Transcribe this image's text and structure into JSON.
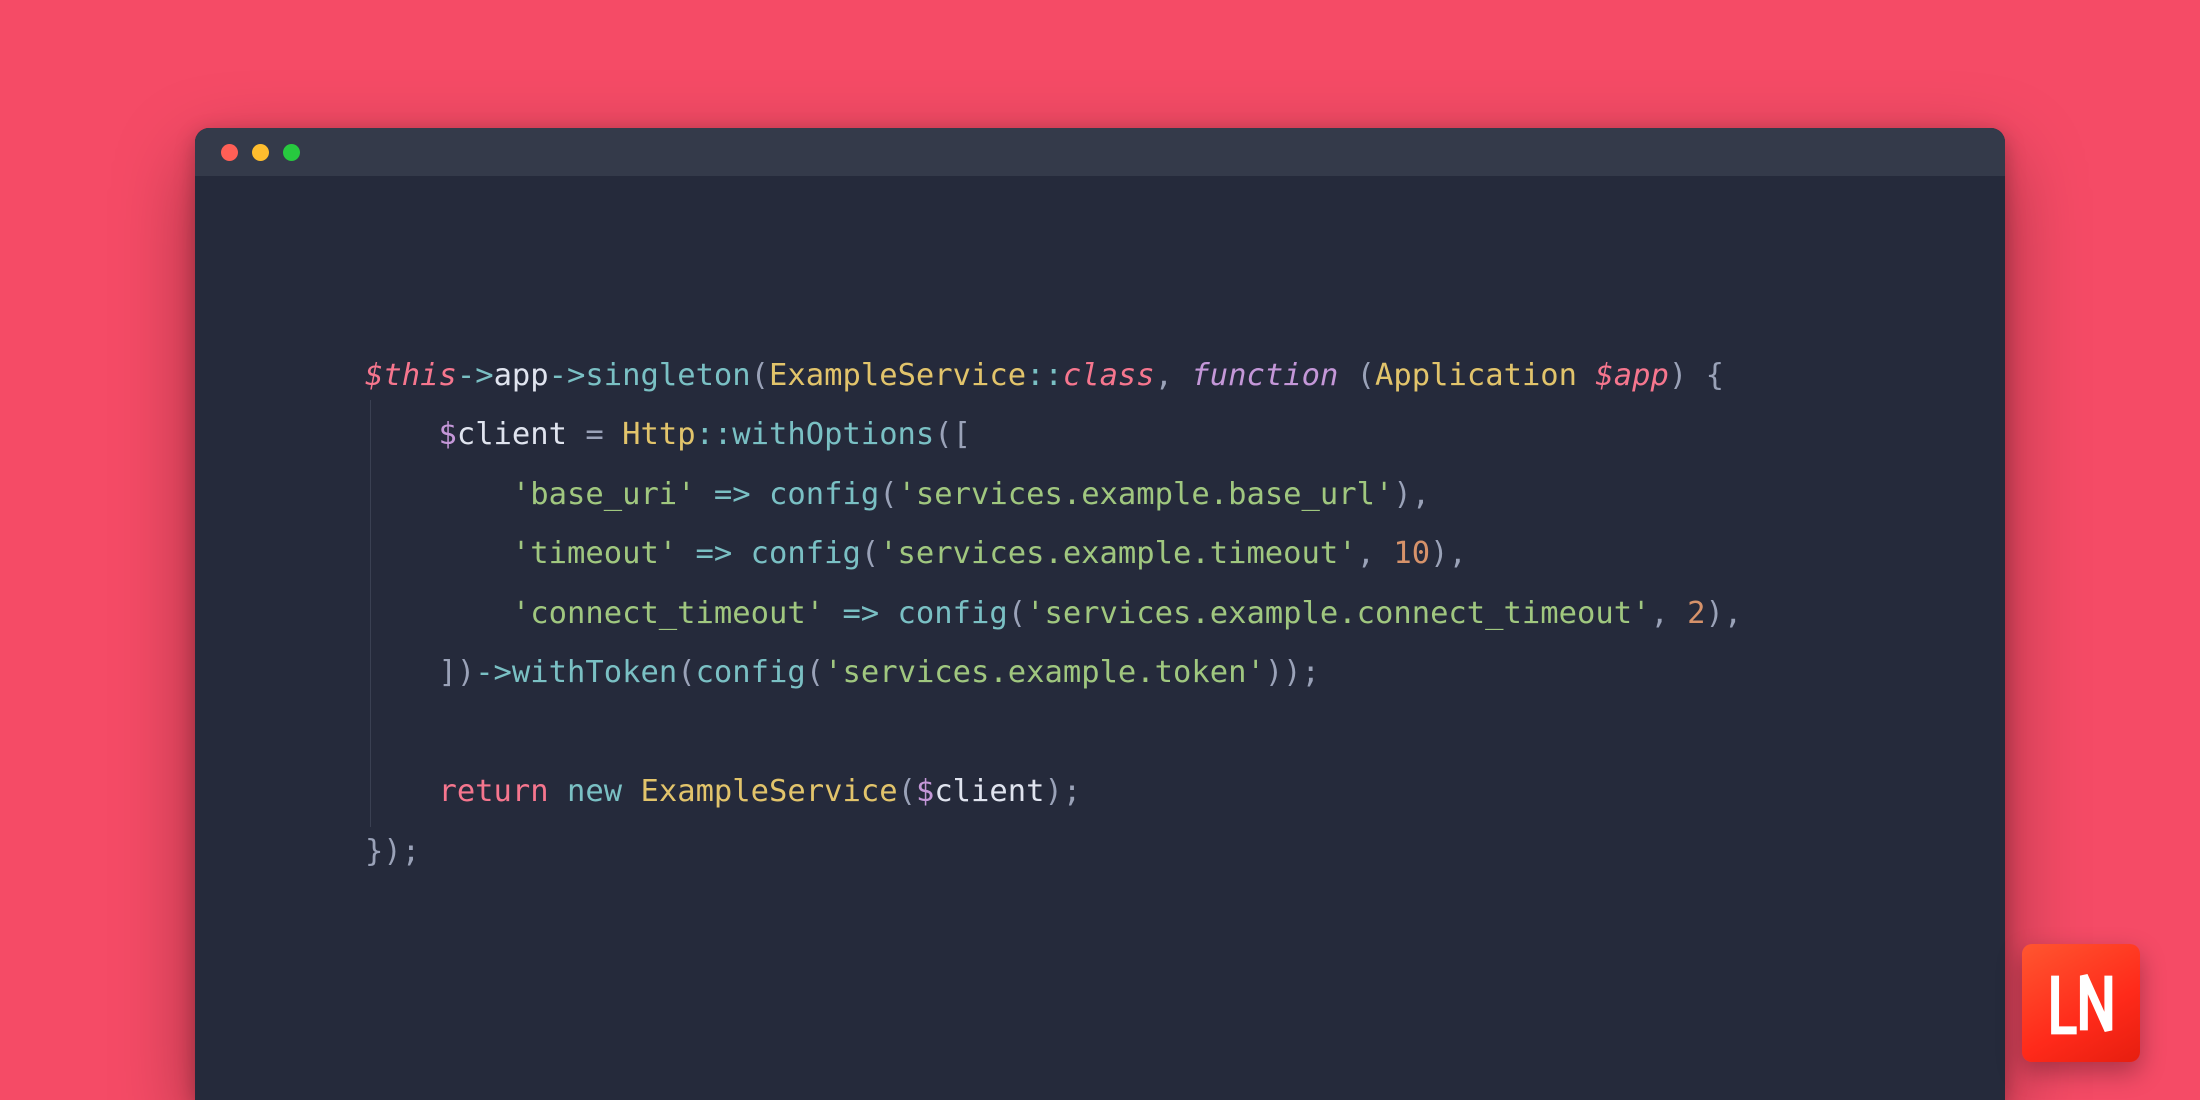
{
  "colors": {
    "page_bg": "#f54b66",
    "window_bg": "#252a3b",
    "titlebar_bg": "#343a4a",
    "traffic_red": "#ff5f56",
    "traffic_yellow": "#ffbd2e",
    "traffic_green": "#27c93f",
    "logo_bg_from": "#ff5630",
    "logo_bg_to": "#e61e0f"
  },
  "code": {
    "this_var": "$this",
    "arrow": "->",
    "app_prop": "app",
    "singleton": "singleton",
    "example_service": "ExampleService",
    "scope": "::",
    "class_const": "class",
    "comma_sp": ", ",
    "function_kw": "function",
    "sp_open": " (",
    "application_type": "Application",
    "space": " ",
    "app_param": "$app",
    "close_brace_open": ") {",
    "indent": "    ",
    "indent2": "        ",
    "client_var": "$client",
    "equals": " = ",
    "http_class": "Http",
    "withOptions": "withOptions",
    "open_arr": "([",
    "str_base_uri": "'base_uri'",
    "fat_arrow": " => ",
    "config_fn": "config",
    "open_p": "(",
    "str_base_url": "'services.example.base_url'",
    "close_p_comma": "),",
    "str_timeout": "'timeout'",
    "str_timeout_key": "'services.example.timeout'",
    "num_10": "10",
    "str_ctimeout": "'connect_timeout'",
    "str_ctimeout_key": "'services.example.connect_timeout'",
    "num_2": "2",
    "close_arr": "])",
    "withToken": "withToken",
    "str_token": "'services.example.token'",
    "close_pp_semi": "));",
    "return_kw": "return",
    "new_kw": "new",
    "open_p_plain": "(",
    "close_p_semi": ");",
    "close_fn": "});"
  },
  "logo": {
    "letters": "LN"
  }
}
